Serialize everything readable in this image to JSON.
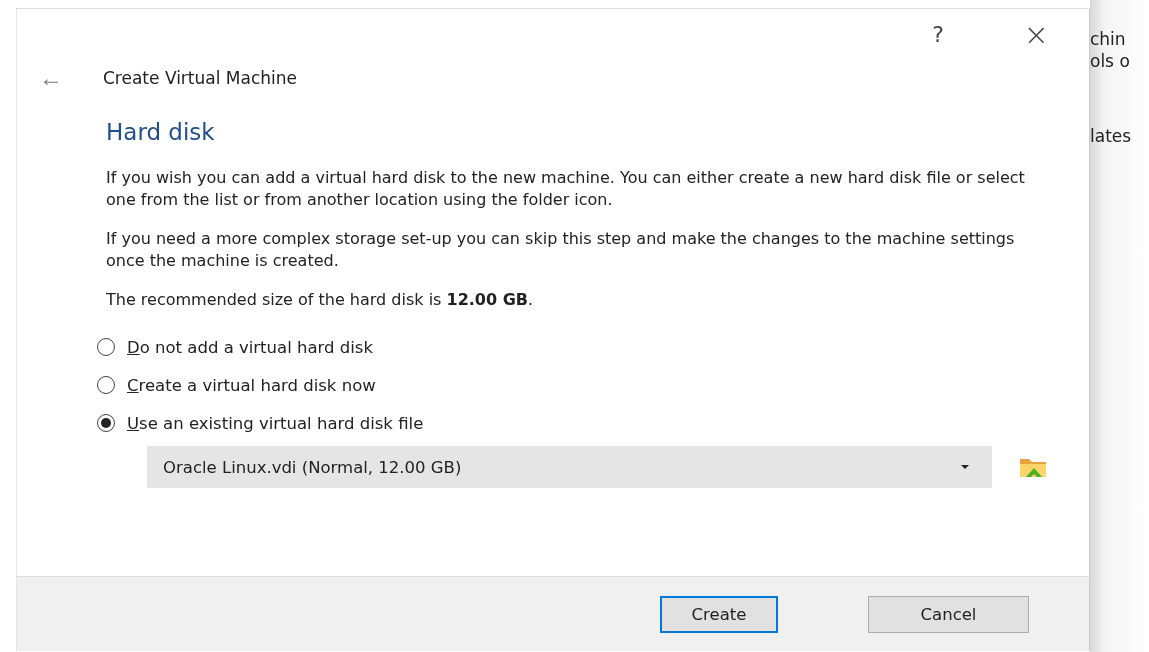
{
  "background_window": {
    "right_texts": [
      "chin",
      "ols o",
      "lates"
    ]
  },
  "dialog": {
    "help": "?",
    "close": "×",
    "back": "←",
    "title": "Create Virtual Machine",
    "heading": "Hard disk",
    "paragraphs": [
      "If you wish you can add a virtual hard disk to the new machine. You can either create a new hard disk file or select one from the list or from another location using the folder icon.",
      "If you need a more complex storage set-up you can skip this step and make the changes to the machine settings once the machine is created.",
      "The recommended size of the hard disk is **12.00 GB**."
    ],
    "options": [
      {
        "label": "Do not add a virtual hard disk",
        "selected": false
      },
      {
        "label": "Create a virtual hard disk now",
        "selected": false
      },
      {
        "label": "Use an existing virtual hard disk file",
        "selected": true
      }
    ],
    "disk_select": {
      "value": "Oracle Linux.vdi (Normal, 12.00 GB)"
    },
    "buttons": [
      {
        "label": "Create",
        "default": true
      },
      {
        "label": "Cancel",
        "default": false
      }
    ]
  }
}
